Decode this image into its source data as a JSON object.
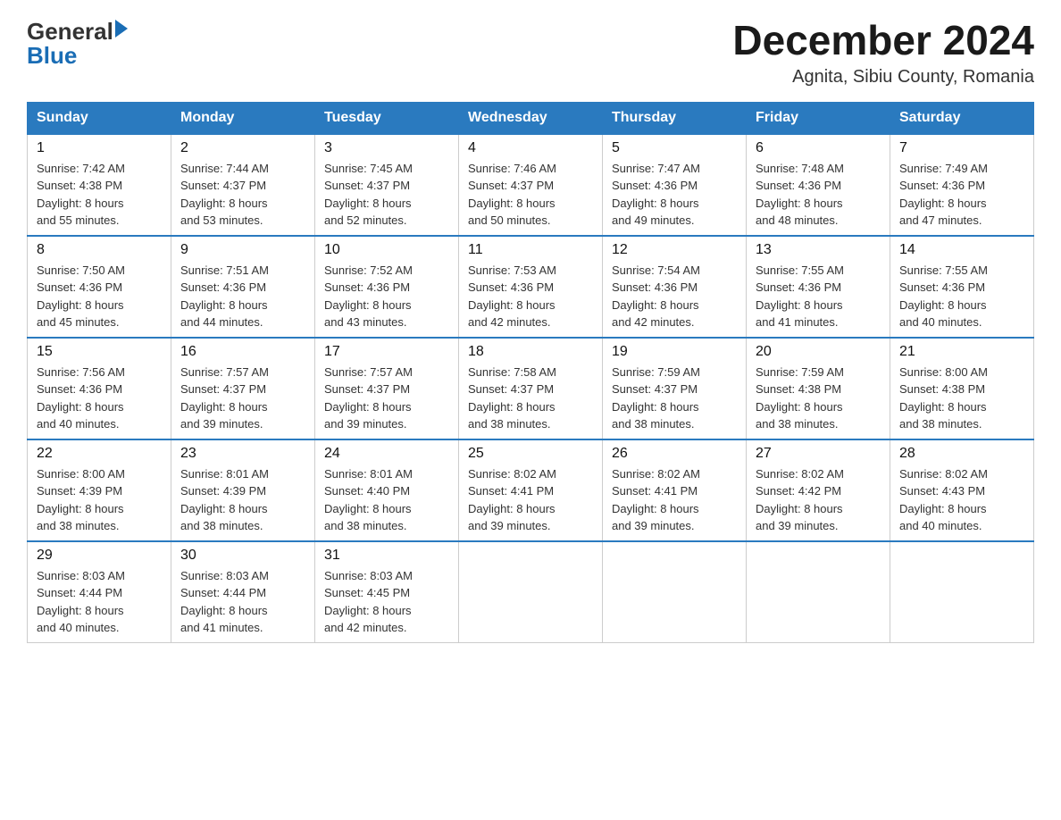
{
  "header": {
    "logo_general": "General",
    "logo_blue": "Blue",
    "title": "December 2024",
    "subtitle": "Agnita, Sibiu County, Romania"
  },
  "days_of_week": [
    "Sunday",
    "Monday",
    "Tuesday",
    "Wednesday",
    "Thursday",
    "Friday",
    "Saturday"
  ],
  "weeks": [
    [
      {
        "day": "1",
        "sunrise": "7:42 AM",
        "sunset": "4:38 PM",
        "daylight": "8 hours and 55 minutes."
      },
      {
        "day": "2",
        "sunrise": "7:44 AM",
        "sunset": "4:37 PM",
        "daylight": "8 hours and 53 minutes."
      },
      {
        "day": "3",
        "sunrise": "7:45 AM",
        "sunset": "4:37 PM",
        "daylight": "8 hours and 52 minutes."
      },
      {
        "day": "4",
        "sunrise": "7:46 AM",
        "sunset": "4:37 PM",
        "daylight": "8 hours and 50 minutes."
      },
      {
        "day": "5",
        "sunrise": "7:47 AM",
        "sunset": "4:36 PM",
        "daylight": "8 hours and 49 minutes."
      },
      {
        "day": "6",
        "sunrise": "7:48 AM",
        "sunset": "4:36 PM",
        "daylight": "8 hours and 48 minutes."
      },
      {
        "day": "7",
        "sunrise": "7:49 AM",
        "sunset": "4:36 PM",
        "daylight": "8 hours and 47 minutes."
      }
    ],
    [
      {
        "day": "8",
        "sunrise": "7:50 AM",
        "sunset": "4:36 PM",
        "daylight": "8 hours and 45 minutes."
      },
      {
        "day": "9",
        "sunrise": "7:51 AM",
        "sunset": "4:36 PM",
        "daylight": "8 hours and 44 minutes."
      },
      {
        "day": "10",
        "sunrise": "7:52 AM",
        "sunset": "4:36 PM",
        "daylight": "8 hours and 43 minutes."
      },
      {
        "day": "11",
        "sunrise": "7:53 AM",
        "sunset": "4:36 PM",
        "daylight": "8 hours and 42 minutes."
      },
      {
        "day": "12",
        "sunrise": "7:54 AM",
        "sunset": "4:36 PM",
        "daylight": "8 hours and 42 minutes."
      },
      {
        "day": "13",
        "sunrise": "7:55 AM",
        "sunset": "4:36 PM",
        "daylight": "8 hours and 41 minutes."
      },
      {
        "day": "14",
        "sunrise": "7:55 AM",
        "sunset": "4:36 PM",
        "daylight": "8 hours and 40 minutes."
      }
    ],
    [
      {
        "day": "15",
        "sunrise": "7:56 AM",
        "sunset": "4:36 PM",
        "daylight": "8 hours and 40 minutes."
      },
      {
        "day": "16",
        "sunrise": "7:57 AM",
        "sunset": "4:37 PM",
        "daylight": "8 hours and 39 minutes."
      },
      {
        "day": "17",
        "sunrise": "7:57 AM",
        "sunset": "4:37 PM",
        "daylight": "8 hours and 39 minutes."
      },
      {
        "day": "18",
        "sunrise": "7:58 AM",
        "sunset": "4:37 PM",
        "daylight": "8 hours and 38 minutes."
      },
      {
        "day": "19",
        "sunrise": "7:59 AM",
        "sunset": "4:37 PM",
        "daylight": "8 hours and 38 minutes."
      },
      {
        "day": "20",
        "sunrise": "7:59 AM",
        "sunset": "4:38 PM",
        "daylight": "8 hours and 38 minutes."
      },
      {
        "day": "21",
        "sunrise": "8:00 AM",
        "sunset": "4:38 PM",
        "daylight": "8 hours and 38 minutes."
      }
    ],
    [
      {
        "day": "22",
        "sunrise": "8:00 AM",
        "sunset": "4:39 PM",
        "daylight": "8 hours and 38 minutes."
      },
      {
        "day": "23",
        "sunrise": "8:01 AM",
        "sunset": "4:39 PM",
        "daylight": "8 hours and 38 minutes."
      },
      {
        "day": "24",
        "sunrise": "8:01 AM",
        "sunset": "4:40 PM",
        "daylight": "8 hours and 38 minutes."
      },
      {
        "day": "25",
        "sunrise": "8:02 AM",
        "sunset": "4:41 PM",
        "daylight": "8 hours and 39 minutes."
      },
      {
        "day": "26",
        "sunrise": "8:02 AM",
        "sunset": "4:41 PM",
        "daylight": "8 hours and 39 minutes."
      },
      {
        "day": "27",
        "sunrise": "8:02 AM",
        "sunset": "4:42 PM",
        "daylight": "8 hours and 39 minutes."
      },
      {
        "day": "28",
        "sunrise": "8:02 AM",
        "sunset": "4:43 PM",
        "daylight": "8 hours and 40 minutes."
      }
    ],
    [
      {
        "day": "29",
        "sunrise": "8:03 AM",
        "sunset": "4:44 PM",
        "daylight": "8 hours and 40 minutes."
      },
      {
        "day": "30",
        "sunrise": "8:03 AM",
        "sunset": "4:44 PM",
        "daylight": "8 hours and 41 minutes."
      },
      {
        "day": "31",
        "sunrise": "8:03 AM",
        "sunset": "4:45 PM",
        "daylight": "8 hours and 42 minutes."
      },
      null,
      null,
      null,
      null
    ]
  ],
  "labels": {
    "sunrise": "Sunrise:",
    "sunset": "Sunset:",
    "daylight": "Daylight:"
  }
}
